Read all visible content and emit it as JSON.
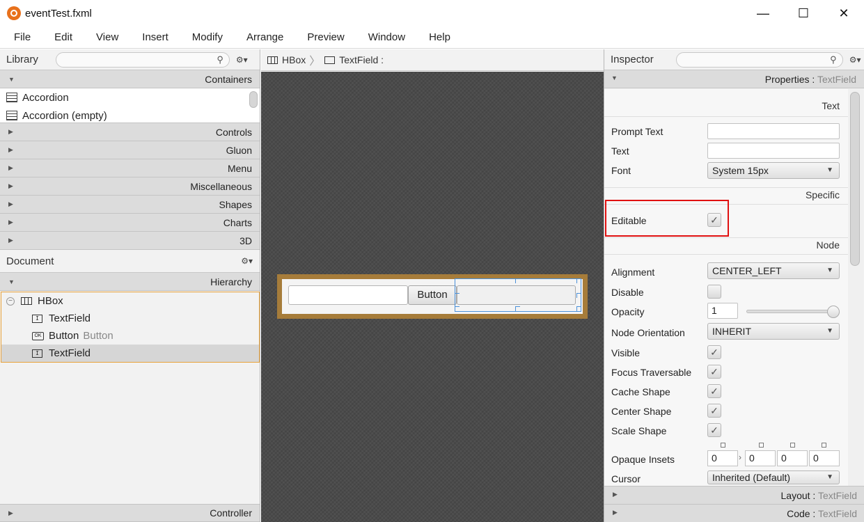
{
  "window": {
    "title": "eventTest.fxml",
    "controls": {
      "minimize": "—",
      "maximize": "☐",
      "close": "✕"
    }
  },
  "menu": [
    "File",
    "Edit",
    "View",
    "Insert",
    "Modify",
    "Arrange",
    "Preview",
    "Window",
    "Help"
  ],
  "library": {
    "title": "Library",
    "search_icon": "search-icon",
    "sections": {
      "containers": "Containers",
      "controls": "Controls",
      "gluon": "Gluon",
      "menu": "Menu",
      "miscellaneous": "Miscellaneous",
      "shapes": "Shapes",
      "charts": "Charts",
      "threed": "3D"
    },
    "items": [
      "Accordion",
      "Accordion  (empty)"
    ]
  },
  "document": {
    "title": "Document",
    "hierarchy_label": "Hierarchy",
    "controller_label": "Controller",
    "tree": {
      "root": "HBox",
      "child1": "TextField",
      "child2": "Button",
      "child2_sub": "Button",
      "child3": "TextField"
    }
  },
  "breadcrumb": {
    "first": "HBox",
    "second": "TextField :"
  },
  "preview": {
    "button_label": "Button"
  },
  "inspector": {
    "title": "Inspector",
    "properties_label": "Properties",
    "properties_target": "TextField",
    "groups": {
      "text": "Text",
      "specific": "Specific",
      "node": "Node"
    },
    "labels": {
      "prompt_text": "Prompt Text",
      "text": "Text",
      "font": "Font",
      "editable": "Editable",
      "alignment": "Alignment",
      "disable": "Disable",
      "opacity": "Opacity",
      "node_orientation": "Node Orientation",
      "visible": "Visible",
      "focus_traversable": "Focus Traversable",
      "cache_shape": "Cache Shape",
      "center_shape": "Center Shape",
      "scale_shape": "Scale Shape",
      "opaque_insets": "Opaque Insets",
      "cursor": "Cursor"
    },
    "values": {
      "prompt_text": "",
      "text": "",
      "font": "System 15px",
      "editable": true,
      "alignment": "CENTER_LEFT",
      "disable": false,
      "opacity": "1",
      "opacity_level": 1.0,
      "node_orientation": "INHERIT",
      "visible": true,
      "focus_traversable": true,
      "cache_shape": true,
      "center_shape": true,
      "scale_shape": true,
      "opaque_insets": [
        "0",
        "0",
        "0",
        "0"
      ],
      "cursor": "Inherited (Default)"
    },
    "layout_label": "Layout",
    "layout_target": "TextField",
    "code_label": "Code",
    "code_target": "TextField",
    "check_glyph": "✓"
  },
  "colors": {
    "accent_orange": "#e8a23a",
    "highlight_red": "#e01010",
    "hbox_frame": "#a67c3a",
    "selection_blue": "#4a90d9",
    "canvas_bg": "#4a4a4a"
  }
}
